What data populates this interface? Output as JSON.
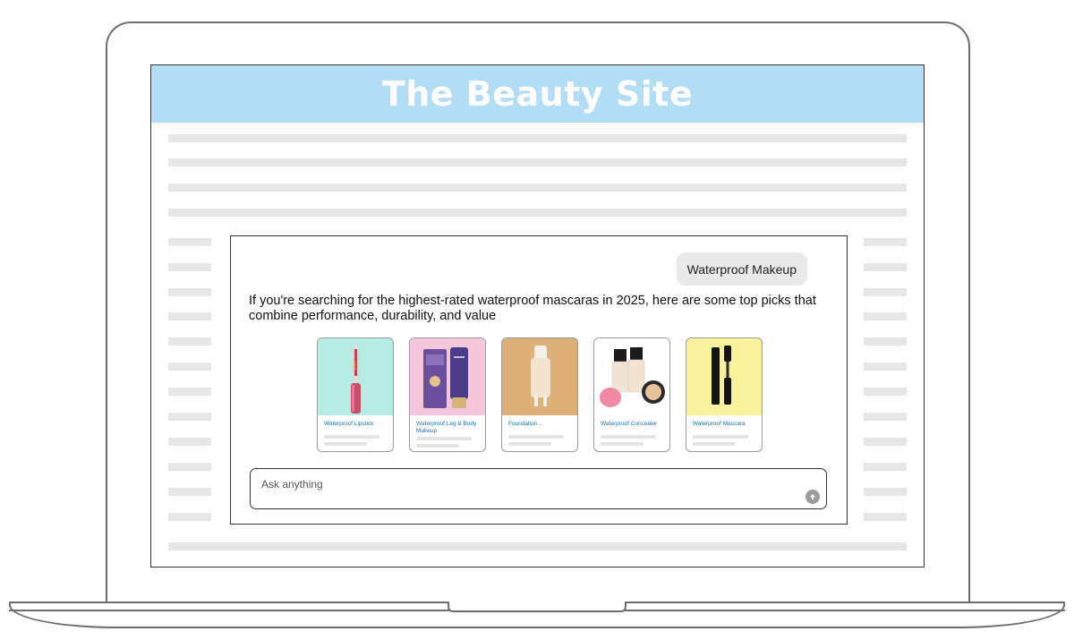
{
  "site": {
    "title": "The Beauty Site"
  },
  "chat": {
    "user_message": "Waterproof Makeup",
    "assistant_message": "If you're searching for the highest-rated waterproof mascaras in 2025, here are some top picks that combine performance, durability, and value",
    "products": [
      {
        "title": "Waterproof Lipstick",
        "bg": "#b7ece4",
        "icon": "lipstick-image"
      },
      {
        "title": "Waterproof Leg & Body Makeup",
        "bg": "#f6c6dd",
        "icon": "body-makeup-image"
      },
      {
        "title": "Foundation...",
        "bg": "#ddb07a",
        "icon": "foundation-image"
      },
      {
        "title": "Waterproof Concealer",
        "bg": "#ffffff",
        "icon": "concealer-image"
      },
      {
        "title": "Waterproof Mascara",
        "bg": "#f8f29c",
        "icon": "mascara-image"
      }
    ],
    "input": {
      "placeholder": "Ask anything",
      "value": ""
    },
    "send_icon": "arrow-up-icon"
  },
  "colors": {
    "header": "#b3dcf5",
    "link": "#1a6fb5",
    "skeleton": "#e6e6e4"
  }
}
